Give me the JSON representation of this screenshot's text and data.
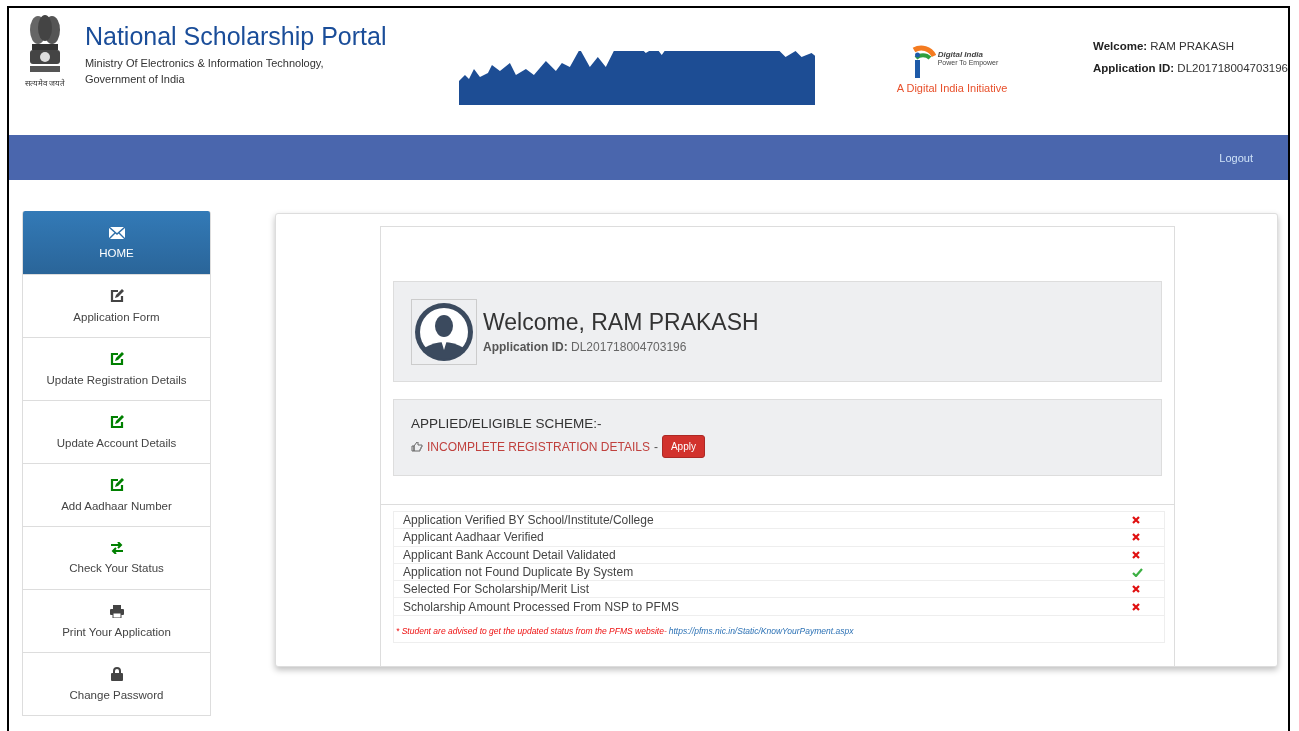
{
  "header": {
    "title": "National Scholarship Portal",
    "subtitle_lines": [
      "Ministry Of Electronics & Information Technology,",
      "Government of India"
    ],
    "emblem_motto": "सत्यमेव जयते",
    "digital_india": {
      "name": "Digital India",
      "tagline": "Power To Empower",
      "caption": "A Digital India Initiative"
    },
    "user": {
      "welcome_label": "Welcome:",
      "welcome_name": "RAM PRAKASH",
      "id_label": "Application ID:",
      "id_value": "DL201718004703196"
    }
  },
  "nav_bar": {
    "logout": "Logout"
  },
  "sidebar": {
    "items": [
      {
        "label": "HOME",
        "selected": true,
        "color": "#ffffff"
      },
      {
        "label": "Application Form",
        "selected": false,
        "color": "#444444"
      },
      {
        "label": "Update Registration Details",
        "selected": false,
        "color": "#008000"
      },
      {
        "label": "Update Account Details",
        "selected": false,
        "color": "#008000"
      },
      {
        "label": "Add Aadhaar Number",
        "selected": false,
        "color": "#008000"
      },
      {
        "label": "Check Your Status",
        "selected": false,
        "color": "#008000"
      },
      {
        "label": "Print Your Application",
        "selected": false,
        "color": "#444444"
      },
      {
        "label": "Change Password",
        "selected": false,
        "color": "#444444"
      }
    ]
  },
  "welcome": {
    "greeting": "Welcome, RAM PRAKASH",
    "id_label": "Application ID:",
    "id_value": "DL201718004703196"
  },
  "scheme": {
    "heading": "APPLIED/ELIGIBLE SCHEME:-",
    "status": "INCOMPLETE REGISTRATION DETAILS",
    "separator": "-",
    "button": "Apply"
  },
  "status_list": {
    "rows": [
      {
        "label": "Application Verified BY School/Institute/College",
        "done": false
      },
      {
        "label": "Applicant Aadhaar Verified",
        "done": false
      },
      {
        "label": "Applicant Bank Account Detail Validated",
        "done": false
      },
      {
        "label": "Application not Found Duplicate By System",
        "done": true
      },
      {
        "label": "Selected For Scholarship/Merit List",
        "done": false
      },
      {
        "label": "Scholarship Amount Processed From NSP to PFMS",
        "done": false
      }
    ],
    "note": "* Student are advised to get the updated status from the PFMS website-",
    "note_link": "https://pfms.nic.in/Static/KnowYourPayment.aspx"
  }
}
